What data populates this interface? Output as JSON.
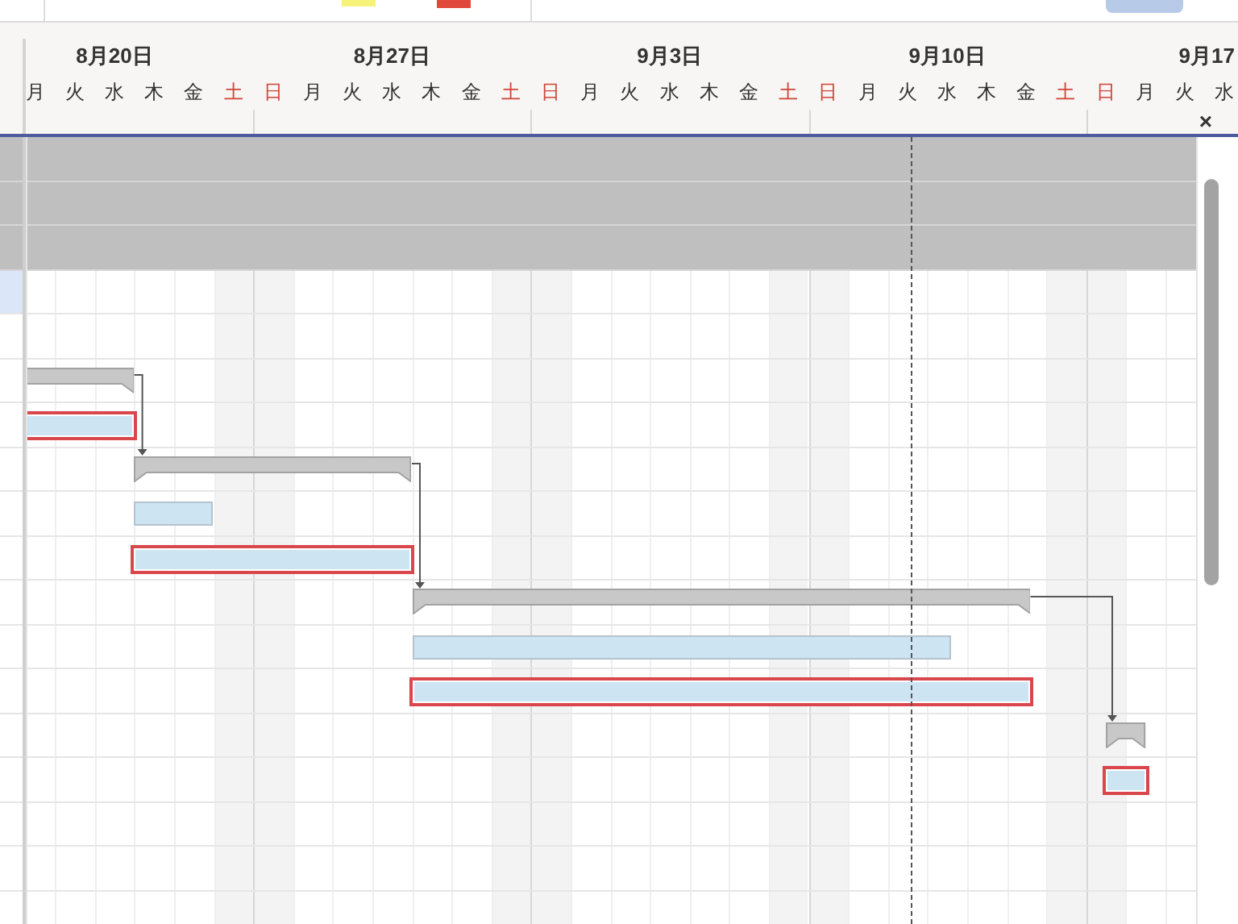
{
  "header": {
    "weeks": [
      {
        "label": "8月20日"
      },
      {
        "label": "8月27日"
      },
      {
        "label": "9月3日"
      },
      {
        "label": "9月10日"
      },
      {
        "label": "9月17"
      }
    ],
    "days": [
      {
        "label": "月",
        "holiday": false
      },
      {
        "label": "火",
        "holiday": false
      },
      {
        "label": "水",
        "holiday": false
      },
      {
        "label": "木",
        "holiday": false
      },
      {
        "label": "金",
        "holiday": false
      },
      {
        "label": "土",
        "holiday": true
      },
      {
        "label": "日",
        "holiday": true
      },
      {
        "label": "月",
        "holiday": false
      },
      {
        "label": "火",
        "holiday": false
      },
      {
        "label": "水",
        "holiday": false
      },
      {
        "label": "木",
        "holiday": false
      },
      {
        "label": "金",
        "holiday": false
      },
      {
        "label": "土",
        "holiday": true
      },
      {
        "label": "日",
        "holiday": true
      },
      {
        "label": "月",
        "holiday": false
      },
      {
        "label": "火",
        "holiday": false
      },
      {
        "label": "水",
        "holiday": false
      },
      {
        "label": "木",
        "holiday": false
      },
      {
        "label": "金",
        "holiday": false
      },
      {
        "label": "土",
        "holiday": true
      },
      {
        "label": "日",
        "holiday": true
      },
      {
        "label": "月",
        "holiday": false
      },
      {
        "label": "火",
        "holiday": false
      },
      {
        "label": "水",
        "holiday": false
      },
      {
        "label": "木",
        "holiday": false
      },
      {
        "label": "金",
        "holiday": false
      },
      {
        "label": "土",
        "holiday": true
      },
      {
        "label": "日",
        "holiday": true
      },
      {
        "label": "月",
        "holiday": false
      },
      {
        "label": "火",
        "holiday": false
      },
      {
        "label": "水",
        "holiday": false
      }
    ],
    "close": "×"
  },
  "rows": [
    {
      "kind": "band"
    },
    {
      "kind": "band"
    },
    {
      "kind": "band"
    },
    {
      "kind": "blank",
      "selected": true
    },
    {
      "kind": "blank",
      "selected": false
    },
    {
      "kind": "summary",
      "selected": false
    },
    {
      "kind": "task",
      "selected": false,
      "critical": true
    },
    {
      "kind": "summary",
      "selected": false
    },
    {
      "kind": "task",
      "selected": false,
      "critical": false
    },
    {
      "kind": "task",
      "selected": false,
      "critical": true
    },
    {
      "kind": "summary",
      "selected": false
    },
    {
      "kind": "task",
      "selected": false,
      "critical": false
    },
    {
      "kind": "task",
      "selected": false,
      "critical": true
    },
    {
      "kind": "summary",
      "selected": false
    },
    {
      "kind": "task",
      "selected": false,
      "critical": true
    },
    {
      "kind": "blank",
      "selected": false
    },
    {
      "kind": "blank",
      "selected": false
    },
    {
      "kind": "blank",
      "selected": false
    }
  ]
}
